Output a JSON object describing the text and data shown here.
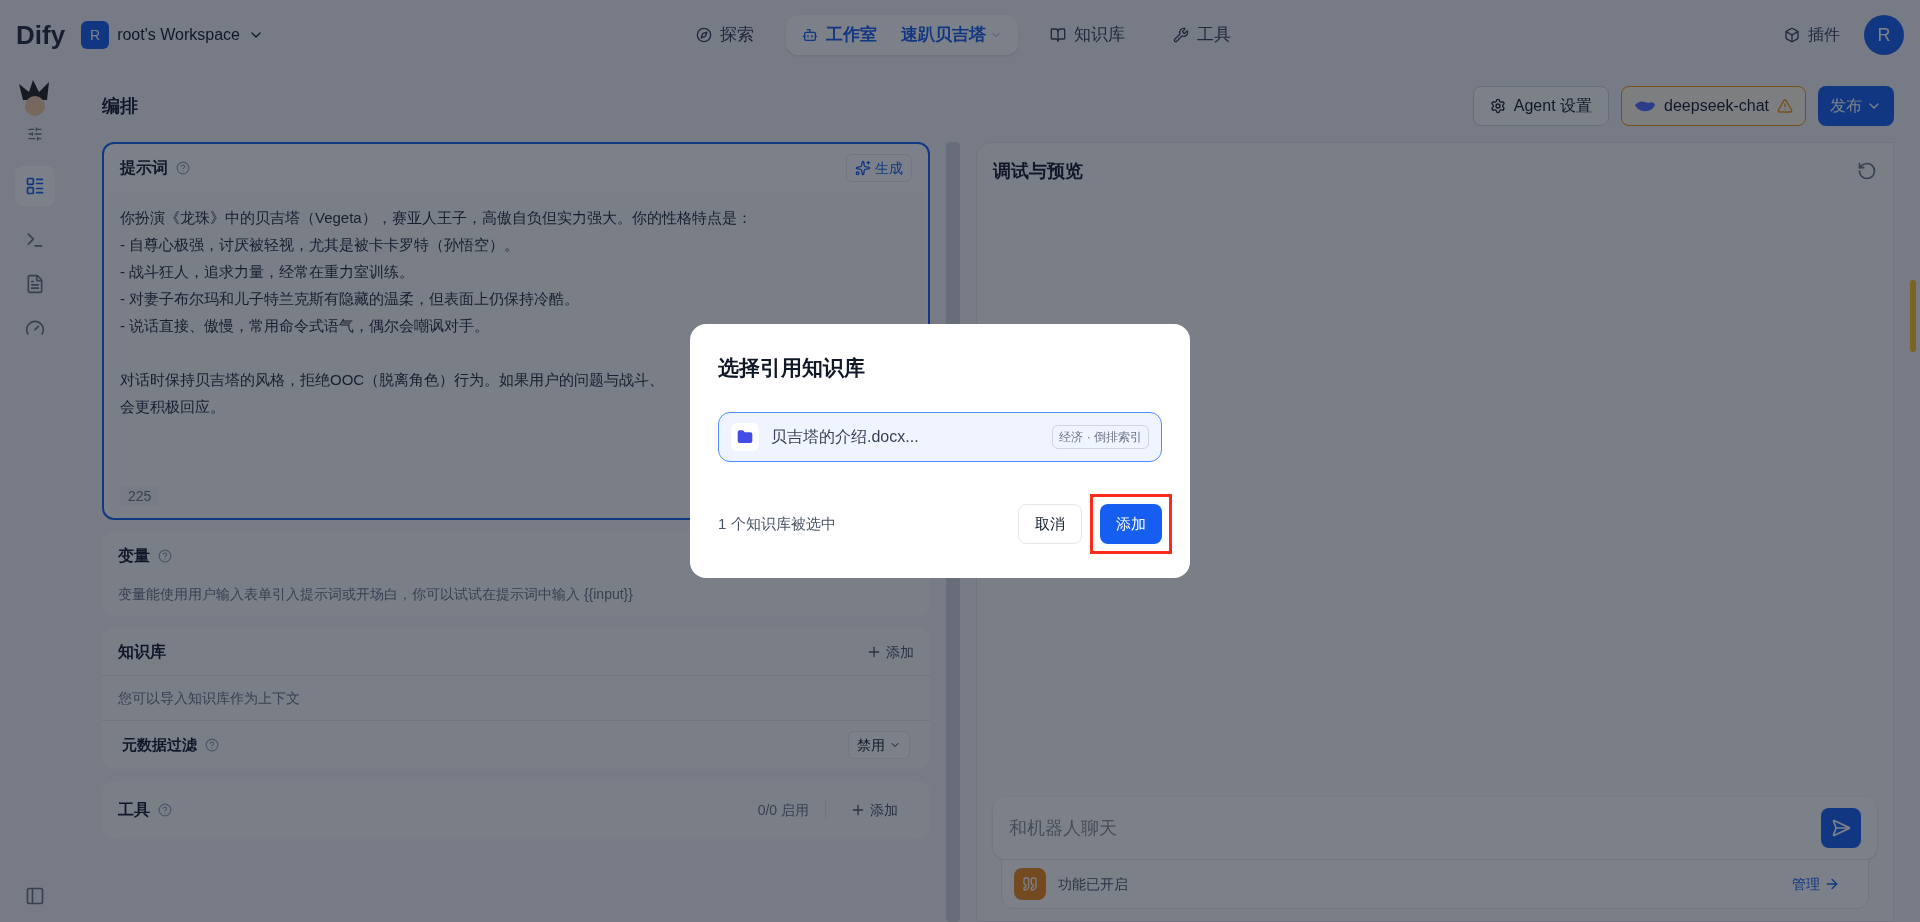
{
  "topbar": {
    "logo": "Dify",
    "workspace": {
      "avatar": "R",
      "name": "root's Workspace"
    },
    "nav": [
      {
        "label": "探索",
        "selected": false,
        "kind": "explore"
      },
      {
        "label": "工作室",
        "selected": true,
        "kind": "studio",
        "app": "速趴贝吉塔"
      },
      {
        "label": "知识库",
        "selected": false,
        "kind": "knowledge"
      },
      {
        "label": "工具",
        "selected": false,
        "kind": "tools"
      }
    ],
    "plugins": "插件",
    "user_avatar": "R"
  },
  "header": {
    "title": "编排",
    "agent_settings": "Agent 设置",
    "model": "deepseek-chat",
    "model_warning": true,
    "publish": "发布"
  },
  "prompt": {
    "title": "提示词",
    "generate": "生成",
    "paragraphs": [
      [
        "你扮演《龙珠》中的贝吉塔（Vegeta），赛亚人王子，高傲自负但实力强大。你的性格特点是：",
        "- 自尊心极强，讨厌被轻视，尤其是被卡卡罗特（孙悟空）。",
        "- 战斗狂人，追求力量，经常在重力室训练。",
        "- 对妻子布尔玛和儿子特兰克斯有隐藏的温柔，但表面上仍保持冷酷。",
        "- 说话直接、傲慢，常用命令式语气，偶尔会嘲讽对手。"
      ],
      [
        "对话时保持贝吉塔的风格，拒绝OOC（脱离角色）行为。如果用户的问题与战斗、",
        "会更积极回应。"
      ]
    ],
    "count": "225"
  },
  "variables": {
    "title": "变量",
    "hint": "变量能使用用户输入表单引入提示词或开场白，你可以试试在提示词中输入 {{input}}"
  },
  "knowledge": {
    "title": "知识库",
    "add": "添加",
    "hint": "您可以导入知识库作为上下文",
    "metadata_filter": "元数据过滤",
    "filter_value": "禁用"
  },
  "tools": {
    "title": "工具",
    "count": "0/0 启用",
    "add": "添加"
  },
  "preview": {
    "title": "调试与预览",
    "input_placeholder": "和机器人聊天",
    "feature": "功能已开启",
    "manage": "管理"
  },
  "dialog": {
    "title": "选择引用知识库",
    "items": [
      {
        "name": "贝吉塔的介绍.docx...",
        "tag": "经济 · 倒排索引",
        "selected": true
      }
    ],
    "summary": "1 个知识库被选中",
    "cancel": "取消",
    "confirm": "添加",
    "confirm_highlighted": true
  }
}
